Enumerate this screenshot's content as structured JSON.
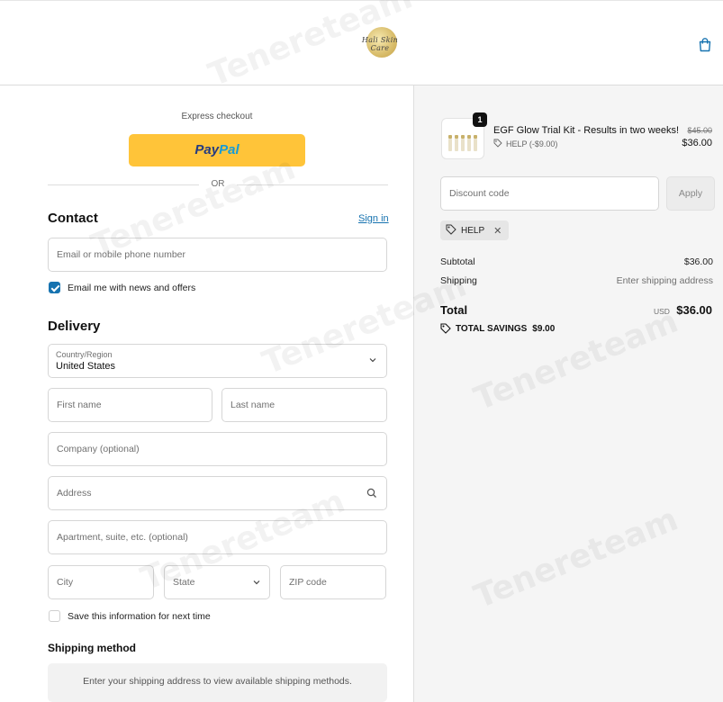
{
  "header": {
    "logo_text": "Hali Skin Care",
    "cart_icon": "shopping-bag-icon"
  },
  "express": {
    "label": "Express checkout",
    "paypal_pay": "Pay",
    "paypal_pal": "Pal",
    "or_label": "OR"
  },
  "contact": {
    "title": "Contact",
    "signin_label": "Sign in",
    "email_placeholder": "Email or mobile phone number",
    "newsletter_label": "Email me with news and offers",
    "newsletter_checked": true
  },
  "delivery": {
    "title": "Delivery",
    "country_label": "Country/Region",
    "country_value": "United States",
    "first_name_placeholder": "First name",
    "last_name_placeholder": "Last name",
    "company_placeholder": "Company (optional)",
    "address_placeholder": "Address",
    "apartment_placeholder": "Apartment, suite, etc. (optional)",
    "city_placeholder": "City",
    "state_placeholder": "State",
    "zip_placeholder": "ZIP code",
    "save_info_label": "Save this information for next time",
    "save_info_checked": false
  },
  "shipping": {
    "title": "Shipping method",
    "placeholder": "Enter your shipping address to view available shipping methods."
  },
  "order": {
    "product_name": "EGF Glow Trial Kit - Results in two weeks!",
    "product_discount": "HELP (-$9.00)",
    "quantity": "1",
    "price_original": "$45.00",
    "price_final": "$36.00",
    "discount_placeholder": "Discount code",
    "apply_label": "Apply",
    "applied_code": "HELP",
    "subtotal_label": "Subtotal",
    "subtotal_value": "$36.00",
    "shipping_label": "Shipping",
    "shipping_value": "Enter shipping address",
    "total_label": "Total",
    "total_currency": "USD",
    "total_value": "$36.00",
    "savings_label": "TOTAL SAVINGS",
    "savings_value": "$9.00"
  },
  "watermark_text": "Tenereteam"
}
